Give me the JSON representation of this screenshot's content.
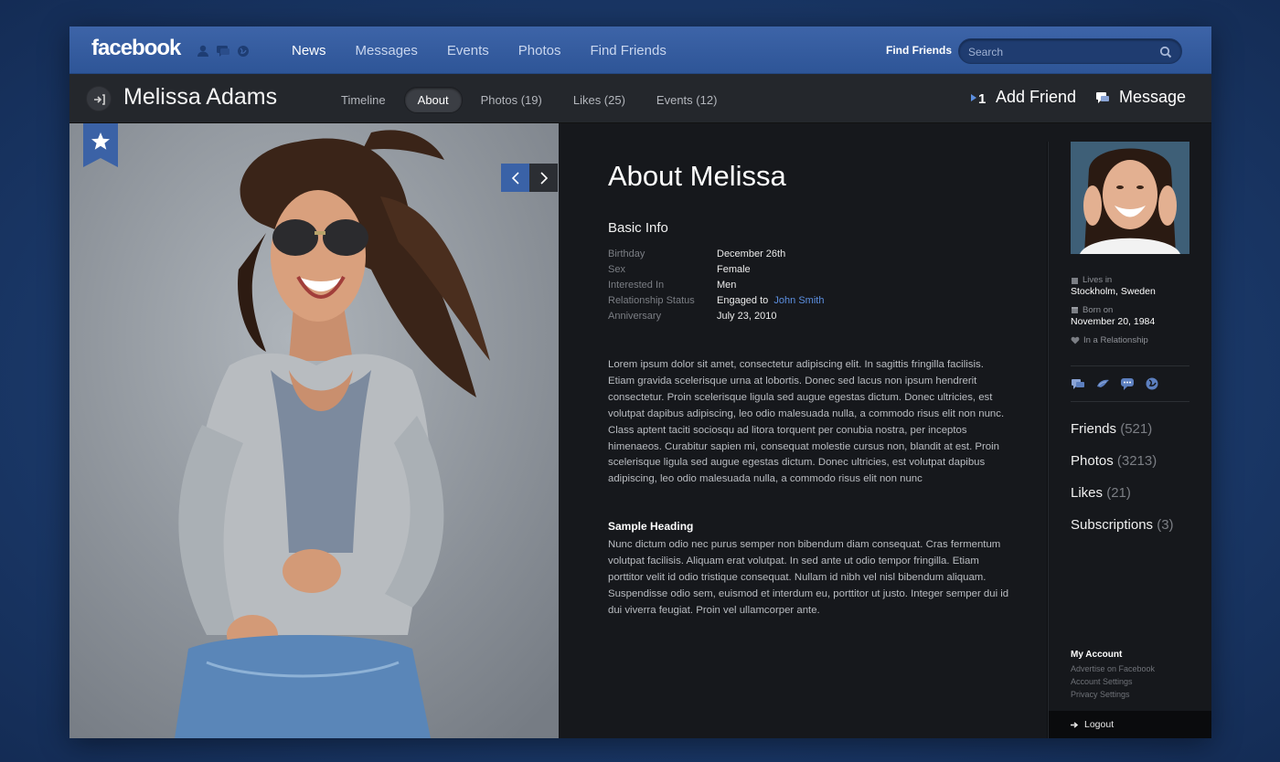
{
  "brand": "facebook",
  "nav": {
    "items": [
      {
        "label": "News",
        "active": true
      },
      {
        "label": "Messages",
        "active": false
      },
      {
        "label": "Events",
        "active": false
      },
      {
        "label": "Photos",
        "active": false
      },
      {
        "label": "Find Friends",
        "active": false
      }
    ],
    "find_friends_label": "Find Friends",
    "search_placeholder": "Search"
  },
  "profile": {
    "name": "Melissa Adams",
    "tabs": [
      {
        "label": "Timeline",
        "active": false
      },
      {
        "label": "About",
        "active": true
      },
      {
        "label": "Photos (19)",
        "active": false
      },
      {
        "label": "Likes (25)",
        "active": false
      },
      {
        "label": "Events (12)",
        "active": false
      }
    ],
    "add_friend_label": "Add Friend",
    "message_label": "Message"
  },
  "about": {
    "title": "About Melissa",
    "basic_info_title": "Basic Info",
    "basic_info": [
      {
        "key": "Birthday",
        "value": "December 26th"
      },
      {
        "key": "Sex",
        "value": "Female"
      },
      {
        "key": "Interested In",
        "value": "Men"
      },
      {
        "key": "Relationship Status",
        "value": "Engaged to ",
        "link": "John Smith"
      },
      {
        "key": "Anniversary",
        "value": "July 23, 2010"
      }
    ],
    "paragraph1": "Lorem ipsum dolor sit amet, consectetur adipiscing elit. In sagittis fringilla facilisis. Etiam gravida scelerisque urna at lobortis. Donec sed lacus non ipsum hendrerit consectetur. Proin scelerisque ligula sed augue egestas dictum. Donec ultricies, est volutpat dapibus adipiscing, leo odio malesuada nulla, a commodo risus elit non nunc. Class aptent taciti sociosqu ad litora torquent per conubia nostra, per inceptos himenaeos. Curabitur sapien mi, consequat molestie cursus non, blandit at est. Proin scelerisque ligula sed augue egestas dictum. Donec ultricies, est volutpat dapibus adipiscing, leo odio malesuada nulla, a commodo risus elit non nunc",
    "sample_heading": "Sample Heading",
    "paragraph2": "Nunc dictum odio nec purus semper non bibendum diam consequat. Cras fermentum volutpat facilisis. Aliquam erat volutpat. In sed ante ut odio tempor fringilla. Etiam porttitor velit id odio tristique consequat. Nullam id nibh vel nisl bibendum aliquam. Suspendisse odio sem, euismod et interdum eu, porttitor ut justo. Integer semper dui id dui viverra feugiat. Proin vel ullamcorper ante."
  },
  "sidebar": {
    "lives_in_label": "Lives in",
    "lives_in_value": "Stockholm, Sweden",
    "born_on_label": "Born on",
    "born_on_value": "November 20, 1984",
    "relationship": "In a Relationship",
    "social_icons": [
      "message-icon",
      "bird-icon",
      "chat-icon",
      "globe-icon"
    ],
    "stats": [
      {
        "label": "Friends",
        "count": "(521)"
      },
      {
        "label": "Photos",
        "count": "(3213)"
      },
      {
        "label": "Likes",
        "count": "(21)"
      },
      {
        "label": "Subscriptions",
        "count": "(3)"
      }
    ],
    "account_heading": "My Account",
    "account_links": [
      "Advertise on Facebook",
      "Account Settings",
      "Privacy Settings"
    ],
    "logout_label": "Logout"
  },
  "colors": {
    "brand_blue": "#3b5998",
    "accent_link": "#5c8fe0",
    "panel_dark": "#16181c"
  }
}
